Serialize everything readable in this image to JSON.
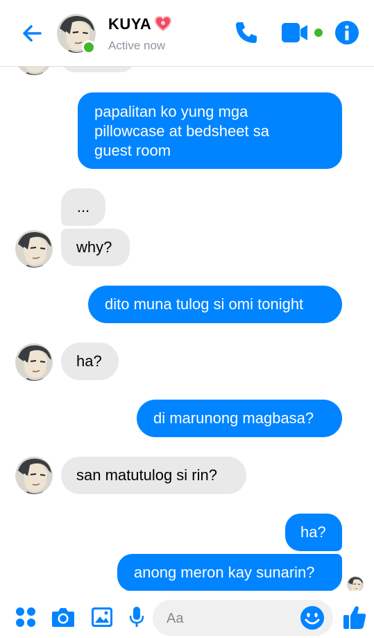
{
  "header": {
    "contact_name": "KUYA",
    "status": "Active now",
    "icons": [
      "back-arrow-icon",
      "heart-icon",
      "phone-icon",
      "video-camera-icon",
      "info-icon"
    ]
  },
  "messages": [
    {
      "from": "other",
      "text": ""
    },
    {
      "from": "me",
      "lines": [
        "papalitan ko yung mga",
        "pillowcase at bedsheet sa",
        "guest room"
      ]
    },
    {
      "from": "other",
      "text": "..."
    },
    {
      "from": "other",
      "text": "why?"
    },
    {
      "from": "me",
      "text": "dito muna tulog si omi tonight"
    },
    {
      "from": "other",
      "text": "ha?"
    },
    {
      "from": "me",
      "text": "di marunong magbasa?"
    },
    {
      "from": "other",
      "text": "san matutulog si rin?"
    },
    {
      "from": "me",
      "text": "ha?"
    },
    {
      "from": "me",
      "text": "anong meron kay sunarin?"
    }
  ],
  "composer": {
    "placeholder": "Aa",
    "icons": [
      "apps-grid-icon",
      "camera-icon",
      "image-icon",
      "microphone-icon",
      "emoji-icon",
      "thumbs-up-icon"
    ]
  },
  "colors": {
    "accent": "#0084ff",
    "incoming": "#e9e9ea",
    "online": "#42b72a"
  }
}
